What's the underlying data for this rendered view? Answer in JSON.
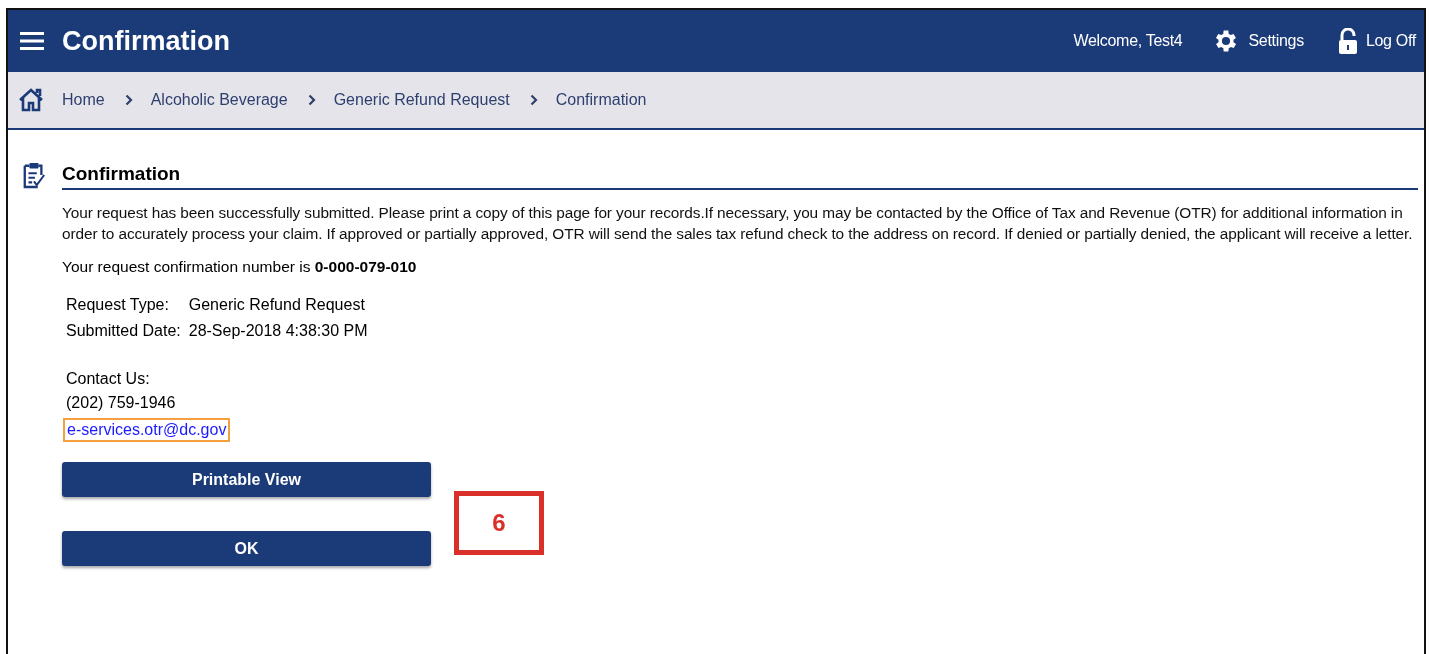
{
  "header": {
    "title": "Confirmation",
    "welcome": "Welcome, Test4",
    "settings": "Settings",
    "logoff": "Log Off"
  },
  "breadcrumbs": [
    "Home",
    "Alcoholic Beverage",
    "Generic Refund Request",
    "Confirmation"
  ],
  "section": {
    "title": "Confirmation",
    "message": "Your request has been successfully submitted. Please print a copy of this page for your records.If necessary, you may be contacted by the Office of Tax and Revenue (OTR) for additional information in order to accurately process your claim. If approved or partially approved, OTR will send the sales tax refund check to the address on record. If denied or partially denied, the applicant will receive a letter.",
    "confirmation": "Your request confirmation number is **0-000-079-010**"
  },
  "details": [
    {
      "label": "Request Type:",
      "value": "Generic Refund Request"
    },
    {
      "label": "Submitted Date:",
      "value": "28-Sep-2018 4:38:30 PM"
    }
  ],
  "contact": {
    "label": "Contact Us:",
    "phone": "(202) 759-1946",
    "email": "e-services.otr@dc.gov",
    "email_focused": true
  },
  "buttons": [
    "Printable View",
    "OK"
  ],
  "callout": "6"
}
